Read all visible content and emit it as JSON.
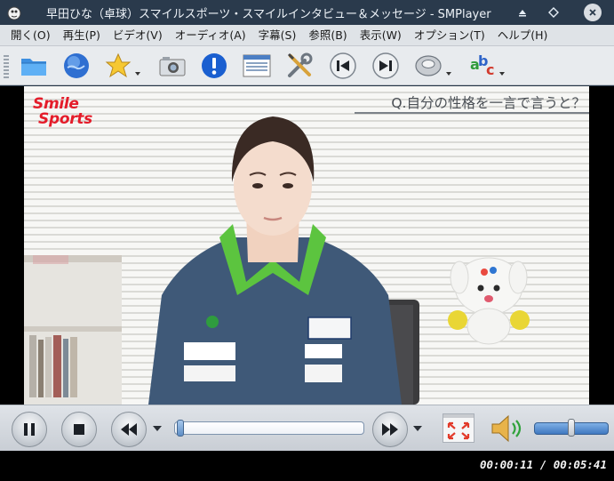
{
  "window": {
    "title": "早田ひな（卓球）スマイルスポーツ・スマイルインタビュー＆メッセージ - SMPlayer",
    "controls": {
      "minimize": "⏶",
      "maximize": "◇",
      "close": "✕"
    }
  },
  "menu": {
    "items": [
      {
        "label": "開く(O)"
      },
      {
        "label": "再生(P)"
      },
      {
        "label": "ビデオ(V)"
      },
      {
        "label": "オーディオ(A)"
      },
      {
        "label": "字幕(S)"
      },
      {
        "label": "参照(B)"
      },
      {
        "label": "表示(W)"
      },
      {
        "label": "オプション(T)"
      },
      {
        "label": "ヘルプ(H)"
      }
    ]
  },
  "toolbar": {
    "buttons": [
      {
        "name": "open-folder-icon"
      },
      {
        "name": "open-url-icon"
      },
      {
        "name": "favorites-icon"
      },
      {
        "name": "screenshot-icon"
      },
      {
        "name": "info-icon"
      },
      {
        "name": "playlist-icon"
      },
      {
        "name": "preferences-icon"
      },
      {
        "name": "previous-icon"
      },
      {
        "name": "next-icon"
      },
      {
        "name": "audio-track-icon"
      },
      {
        "name": "subtitles-icon"
      }
    ]
  },
  "video": {
    "logo_line1": "Smile",
    "logo_line2": "Sports",
    "caption": "Q.自分の性格を一言で言うと？",
    "colors": {
      "logo": "#e41c2a",
      "caption": "#4a4f55"
    }
  },
  "controls": {
    "progress": 0.013,
    "volume": 0.45
  },
  "status": {
    "time": "00:00:11 / 00:05:41"
  }
}
